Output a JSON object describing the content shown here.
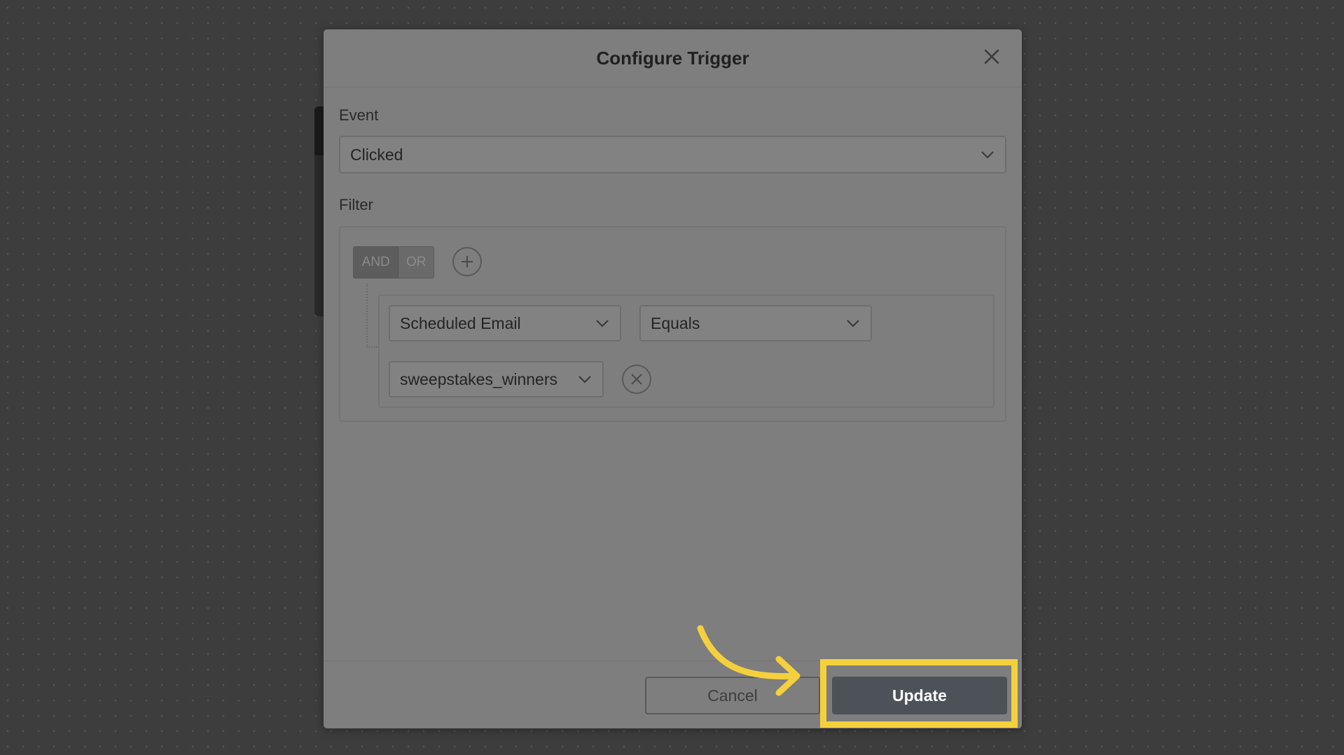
{
  "dialog": {
    "title": "Configure Trigger",
    "event_label": "Event",
    "event_value": "Clicked",
    "filter_label": "Filter",
    "logic_toggle": {
      "and_label": "AND",
      "or_label": "OR",
      "selected": "AND"
    },
    "rule": {
      "field_value": "Scheduled Email",
      "operator_value": "Equals",
      "value_value": "sweepstakes_winners"
    },
    "footer": {
      "cancel_label": "Cancel",
      "update_label": "Update"
    }
  },
  "colors": {
    "highlight": "#f5d03d",
    "update_button": "#4d5158",
    "overlay_background": "#3d3d3d"
  },
  "icons": [
    "close-icon",
    "chevron-down-icon",
    "plus-circle-icon",
    "remove-circle-icon",
    "pointer-arrow"
  ]
}
